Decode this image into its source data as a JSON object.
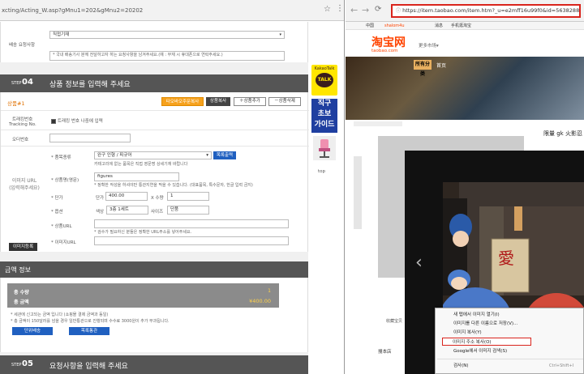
{
  "left": {
    "url": "xcting/Acting_W.asp?gMnu1=202&gMnu2=20202",
    "delivery_label": "배송 요청사항",
    "delivery_select": "직접기재",
    "delivery_note": "* 국내 배송기사 분께 전달하고자 하는 요청사항을 남겨주세요.(예 : 부재 시 휴대폰으로 연락주세요.)",
    "step04_prefix": "STEP",
    "step04_num": "04",
    "step04_title": "상품 정보를 입력해 주세요",
    "product_label": "상품#1",
    "btn_tip": "타오바오주문복사",
    "btn_copy": "상품복사",
    "btn_add": "상품추가",
    "btn_del": "상품삭제",
    "tracking_label_1": "트래킹번호",
    "tracking_label_2": "Tracking No.",
    "tracking_check": "트래킹 번호 나중에 입력",
    "order_label": "오더번호",
    "image_url_1": "이미지 URL",
    "image_url_2": "(입력해주세요)",
    "image_btn": "이미지등록",
    "cat_label": "* 품목종류",
    "cat_value": "완구 인형 / 피규어",
    "cat_btn": "목록출력",
    "cat_hint": "카테고리에 없는 품목은 직접 영문명 상세기재 바랍니다",
    "name_label": "* 상품명(영문)",
    "name_value": "figures",
    "name_hint": "* 정확한 작성을 하셔야만 통관지연을 막을 수 있습니다. (대표품목, 특수문자, 한글 입력 금지)",
    "price_label": "* 단가",
    "price_prefix": "단가",
    "price_value": "400.00",
    "qty_prefix": "X 수량",
    "qty_value": "1",
    "option_label": "* 옵션",
    "color_prefix": "색상",
    "color_value": "3층 1세트",
    "size_prefix": "사이즈",
    "size_value": "단품",
    "product_url_label": "* 상품URL",
    "product_url_hint": "* 검수가 필요하신 분들은 정확한 URL주소를 넣어주세요.",
    "image_url_label": "* 이미지URL",
    "amount_title": "금액 정보",
    "total_qty_label": "총 수량",
    "total_qty": "1",
    "total_price_label": "총 금액",
    "total_price": "¥400.00",
    "notice_1": "* 세관에 신고되는 금액 입니다 (쇼핑몰 결제 금액과 동일)",
    "notice_2": "* 총 금액이 150달러를 넘을 경우 일반통관으로 진행되며 수수료 3000원이 추가 부과됩니다.",
    "btn_single": "단위배송",
    "btn_list": "목록통관",
    "step05_prefix": "STEP",
    "step05_num": "05",
    "step05_title": "요청사항을 입력해 주세요",
    "side_kakao": "KakaoTalk",
    "side_talk": "TALK",
    "side_guide_1": "직구",
    "side_guide_2": "초보",
    "side_guide_3": "가이드",
    "side_top": "top"
  },
  "right": {
    "url": "https://item.taobao.com/item.htm?_u=e2mff16u99f0&id=563828872400",
    "topnav_1": "中国",
    "topnav_2": "shalom4u",
    "topnav_3": "消息",
    "topnav_4": "手机逛淘宝",
    "logo_cn": "淘宝网",
    "logo_en": "taobao.com",
    "more_market": "更多市场",
    "nav_all": "所有分类",
    "nav_home": "首页",
    "product_title": "限量 gk 火影忍",
    "photo_char": "愛",
    "side_text_1": "收藏宝贝",
    "side_text_2": "搜本店",
    "arrow_left": "‹"
  },
  "context_menu": {
    "items": [
      "새 탭에서 이미지 열기(I)",
      "이미지를 다른 이름으로 저장(V)...",
      "이미지 복사(Y)",
      "이미지 주소 복사(O)",
      "Google에서 이미지 검색(S)",
      "검사(N)"
    ],
    "shortcut": "Ctrl+Shift+I",
    "highlight_color": "#d9241c"
  },
  "colors": {
    "orange": "#f6a11c",
    "taobao_orange": "#ff4400",
    "highlight": "#d9241c"
  }
}
